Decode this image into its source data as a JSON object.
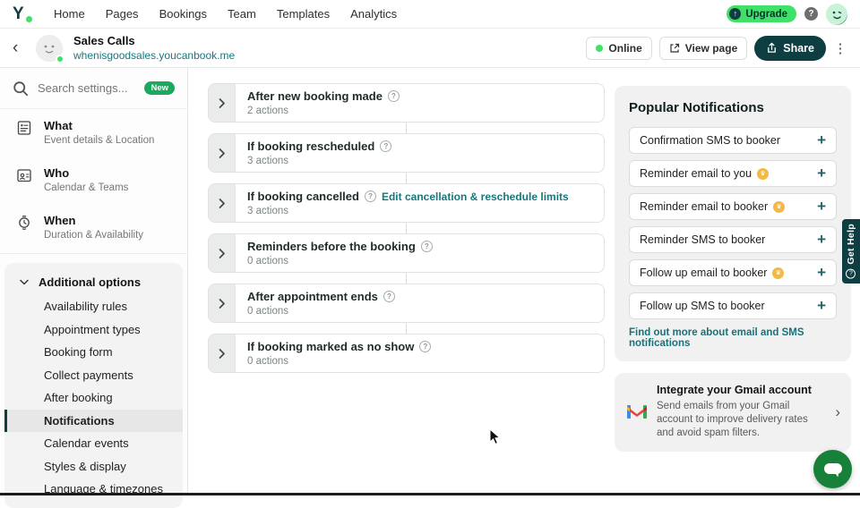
{
  "icons": {
    "question": "?",
    "kebab": "⋮",
    "back": "‹",
    "chevron_right": "›",
    "plus": "+",
    "crown": "♛",
    "upgrade_arrow": "↑"
  },
  "topnav": {
    "items": [
      "Home",
      "Pages",
      "Bookings",
      "Team",
      "Templates",
      "Analytics"
    ],
    "upgrade_label": "Upgrade"
  },
  "header": {
    "title": "Sales Calls",
    "url": "whenisgoodsales.youcanbook.me",
    "online_label": "Online",
    "view_page_label": "View page",
    "share_label": "Share"
  },
  "sidebar": {
    "search_placeholder": "Search settings...",
    "new_badge": "New",
    "sections": [
      {
        "label": "What",
        "sub": "Event details & Location"
      },
      {
        "label": "Who",
        "sub": "Calendar & Teams"
      },
      {
        "label": "When",
        "sub": "Duration & Availability"
      }
    ],
    "additional_label": "Additional options",
    "additional_items": [
      "Availability rules",
      "Appointment types",
      "Booking form",
      "Collect payments",
      "After booking",
      "Notifications",
      "Calendar events",
      "Styles & display",
      "Language & timezones"
    ],
    "selected_item": "Notifications"
  },
  "main": {
    "accordions": [
      {
        "title": "After new booking made",
        "actions": "2 actions"
      },
      {
        "title": "If booking rescheduled",
        "actions": "3 actions"
      },
      {
        "title": "If booking cancelled",
        "actions": "3 actions",
        "link": "Edit cancellation & reschedule limits"
      },
      {
        "title": "Reminders before the booking",
        "actions": "0 actions"
      },
      {
        "title": "After appointment ends",
        "actions": "0 actions"
      },
      {
        "title": "If booking marked as no show",
        "actions": "0 actions"
      }
    ]
  },
  "popular": {
    "title": "Popular Notifications",
    "items": [
      {
        "label": "Confirmation SMS to booker",
        "premium": false
      },
      {
        "label": "Reminder email to you",
        "premium": true
      },
      {
        "label": "Reminder email to booker",
        "premium": true
      },
      {
        "label": "Reminder SMS to booker",
        "premium": false
      },
      {
        "label": "Follow up email to booker",
        "premium": true
      },
      {
        "label": "Follow up SMS to booker",
        "premium": false
      }
    ],
    "link": "Find out more about email and SMS notifications"
  },
  "gmail": {
    "title": "Integrate your Gmail account",
    "description": "Send emails from your Gmail account to improve delivery rates and avoid spam filters."
  },
  "get_help_label": "Get Help",
  "colors": {
    "brand_teal": "#0E3E41",
    "accent_green": "#3FE168",
    "link_teal": "#1B767D",
    "badge_green": "#1CA95E",
    "premium_yellow": "#F3B944",
    "chat_green": "#17813A"
  }
}
